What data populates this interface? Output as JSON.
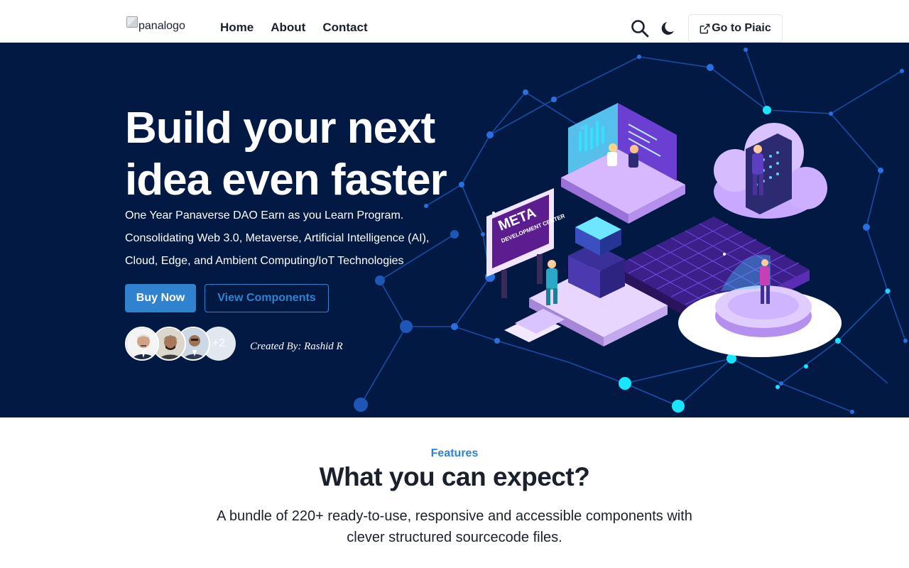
{
  "nav": {
    "logo_alt": "panalogo",
    "links": [
      {
        "label": "Home"
      },
      {
        "label": "About"
      },
      {
        "label": "Contact"
      }
    ],
    "icons": [
      "search-icon",
      "moon-icon",
      "external-link-icon"
    ],
    "cta_label": "Go to Piaic"
  },
  "hero": {
    "title": "Build your next idea even faster",
    "subtitle": "One Year Panaverse DAO Earn as you Learn Program. Consolidating Web 3.0, Metaverse, Artificial Intelligence (AI), Cloud, Edge, and Ambient Computing/IoT Technologies",
    "buy_label": "Buy Now",
    "view_label": "View Components",
    "avatars_more": "+2",
    "created_by": "Created By: Rashid R",
    "sign_title": "META",
    "sign_subtitle": "DEVELOPMENT CENTER"
  },
  "features": {
    "tag": "Features",
    "title": "What you can expect?",
    "description": "A bundle of 220+ ready-to-use, responsive and accessible components with clever structured sourcecode files."
  },
  "colors": {
    "accent": "#3182ce",
    "hero_bg": "#021a43",
    "text_dark": "#1a202c"
  }
}
